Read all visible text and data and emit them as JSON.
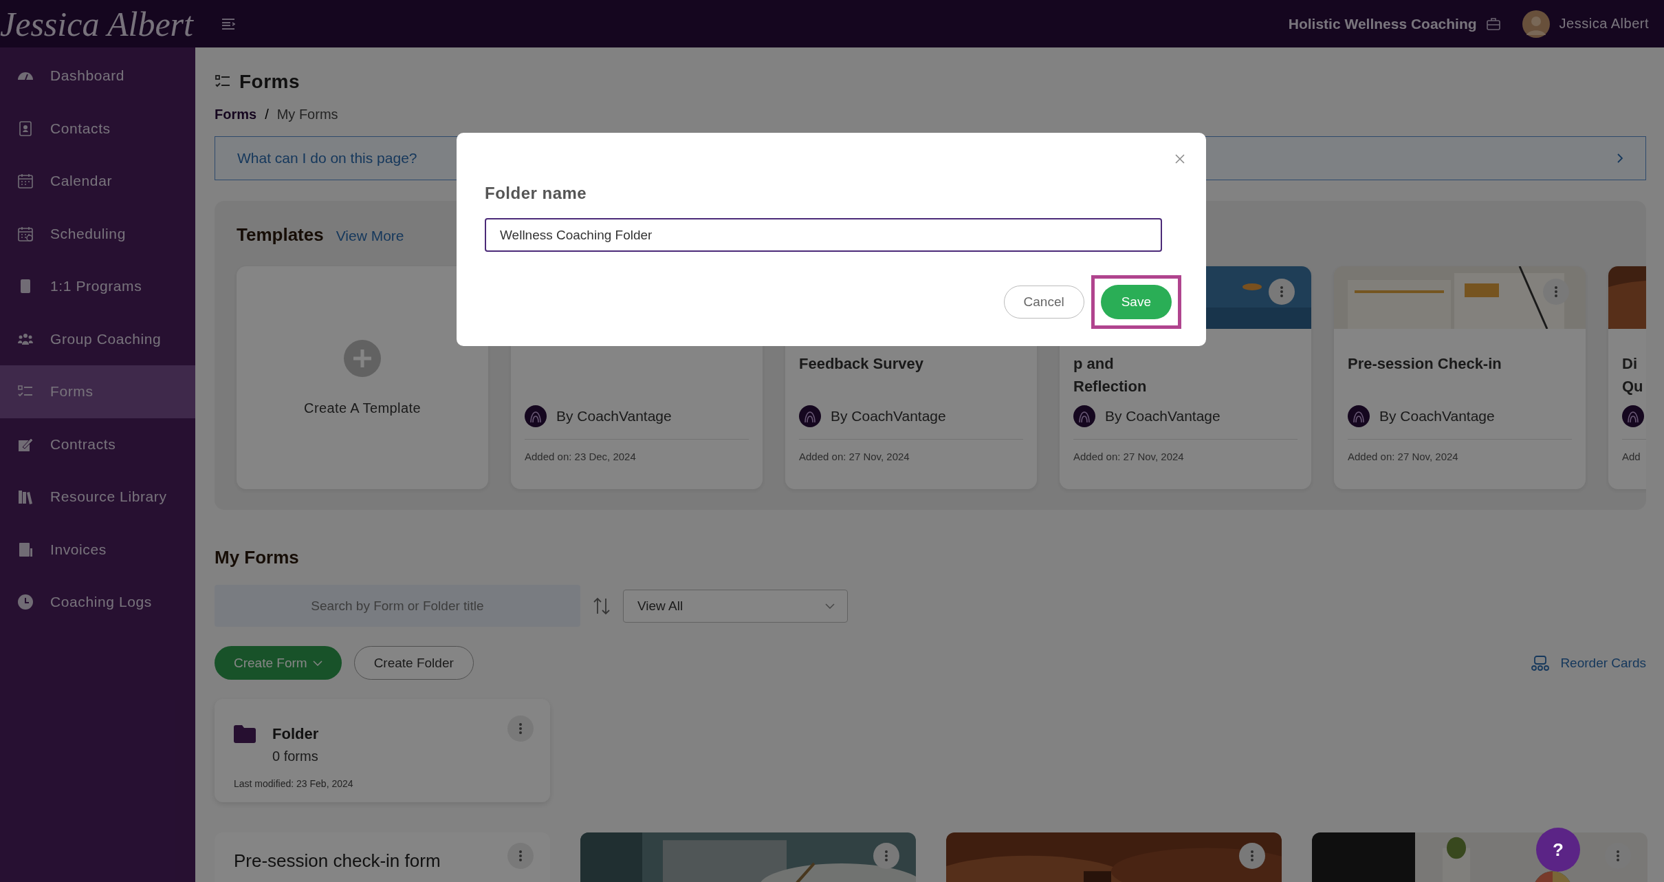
{
  "top_bar": {
    "logo": "Jessica Albert",
    "business": "Holistic Wellness Coaching",
    "user": "Jessica Albert"
  },
  "sidebar": {
    "items": [
      {
        "label": "Dashboard",
        "kind": "gauge",
        "selected": false
      },
      {
        "label": "Contacts",
        "kind": "contacts",
        "selected": false
      },
      {
        "label": "Calendar",
        "kind": "calendar",
        "selected": false
      },
      {
        "label": "Scheduling",
        "kind": "schedule",
        "selected": false
      },
      {
        "label": "1:1 Programs",
        "kind": "book",
        "selected": false
      },
      {
        "label": "Group Coaching",
        "kind": "group",
        "selected": false
      },
      {
        "label": "Forms",
        "kind": "list",
        "selected": true
      },
      {
        "label": "Contracts",
        "kind": "sign",
        "selected": false
      },
      {
        "label": "Resource Library",
        "kind": "library",
        "selected": false
      },
      {
        "label": "Invoices",
        "kind": "invoice",
        "selected": false
      },
      {
        "label": "Coaching Logs",
        "kind": "clock",
        "selected": false
      }
    ]
  },
  "page": {
    "title": "Forms",
    "breadcrumb": [
      "Forms",
      "My Forms"
    ],
    "breadcrumb_separator": "/",
    "help_banner": "What can I do on this page?"
  },
  "templates": {
    "title": "Templates",
    "view_more": "View More",
    "create_label": "Create A Template",
    "cards": [
      {
        "author": "By CoachVantage",
        "added": "Added on: 23 Dec, 2024"
      },
      {
        "title_lines": [
          "Feedback Survey"
        ],
        "author": "By CoachVantage",
        "added": "Added on: 27 Nov, 2024"
      },
      {
        "title_lines": [
          "p and",
          "Reflection"
        ],
        "author": "By CoachVantage",
        "added": "Added on: 27 Nov, 2024",
        "kind": "picture"
      },
      {
        "title_lines": [
          "Pre-session Check-in"
        ],
        "author": "By CoachVantage",
        "added": "Added on: 27 Nov, 2024",
        "kind": "picture"
      },
      {
        "title_lines": [
          "Di",
          "Qu"
        ],
        "added": "Add",
        "kind": "picture"
      }
    ]
  },
  "my_forms": {
    "title": "My Forms",
    "search_placeholder": "Search by Form or Folder title",
    "filter": "View All",
    "create_form": "Create Form",
    "create_folder": "Create Folder",
    "reorder": "Reorder Cards",
    "folders": [
      {
        "name": "Folder",
        "count": "0 forms",
        "modified": "Last modified: 23 Feb, 2024"
      }
    ],
    "forms": [
      {
        "title": "Pre-session check-in form"
      },
      {
        "kind": "picture"
      },
      {
        "kind": "picture"
      },
      {
        "kind": "picture"
      }
    ]
  },
  "modal": {
    "label": "Folder name",
    "value": "Wellness Coaching Folder",
    "cancel": "Cancel",
    "save": "Save",
    "save_highlighted": true
  },
  "help_button": "?"
}
